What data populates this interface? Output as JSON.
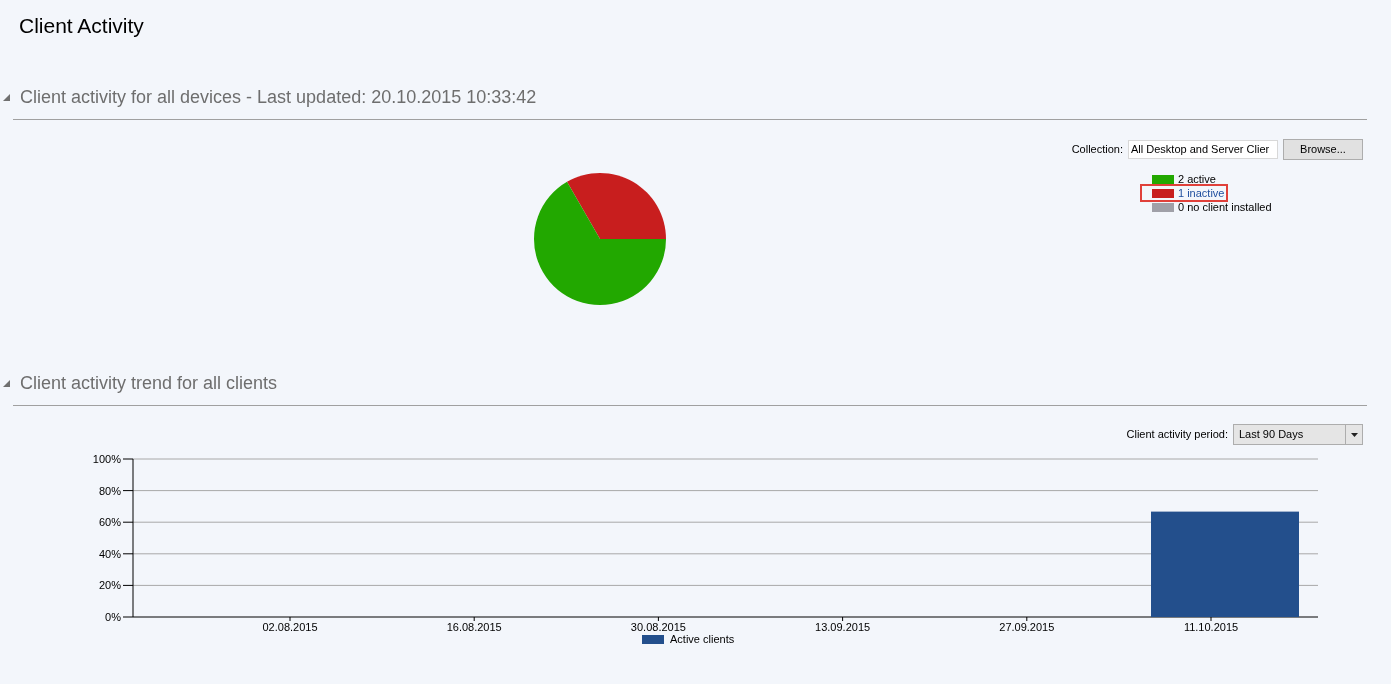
{
  "page_title": "Client Activity",
  "sections": [
    {
      "title": "Client activity for all devices - Last updated: 20.10.2015 10:33:42",
      "expanded": true,
      "collection": {
        "label": "Collection:",
        "value": "All Desktop and Server Clier",
        "button": "Browse..."
      },
      "legend": [
        {
          "label": "2 active",
          "color": "#22a800",
          "highlighted": false
        },
        {
          "label": "1 inactive",
          "color": "#c81e1e",
          "highlighted": true
        },
        {
          "label": "0 no client installed",
          "color": "#a0a0a8",
          "highlighted": false
        }
      ],
      "chart_data": {
        "type": "pie",
        "values": [
          66.67,
          33.33,
          0
        ]
      }
    },
    {
      "title": "Client activity trend for all clients",
      "expanded": true,
      "period": {
        "label": "Client activity period:",
        "value": "Last 90 Days"
      },
      "chart_data": {
        "type": "bar",
        "categories": [
          "02.08.2015",
          "16.08.2015",
          "30.08.2015",
          "13.09.2015",
          "27.09.2015",
          "11.10.2015"
        ],
        "series": [
          {
            "name": "Active clients",
            "color": "#234f8c",
            "values": [
              null,
              null,
              null,
              null,
              null,
              66.7
            ]
          }
        ],
        "ylim": [
          0,
          100
        ],
        "grid": true,
        "yticks": [
          {
            "value": 0,
            "label": "0%"
          },
          {
            "value": 20,
            "label": "20%"
          },
          {
            "value": 40,
            "label": "40%"
          },
          {
            "value": 60,
            "label": "60%"
          },
          {
            "value": 80,
            "label": "80%"
          },
          {
            "value": 100,
            "label": "100%"
          }
        ]
      }
    }
  ]
}
